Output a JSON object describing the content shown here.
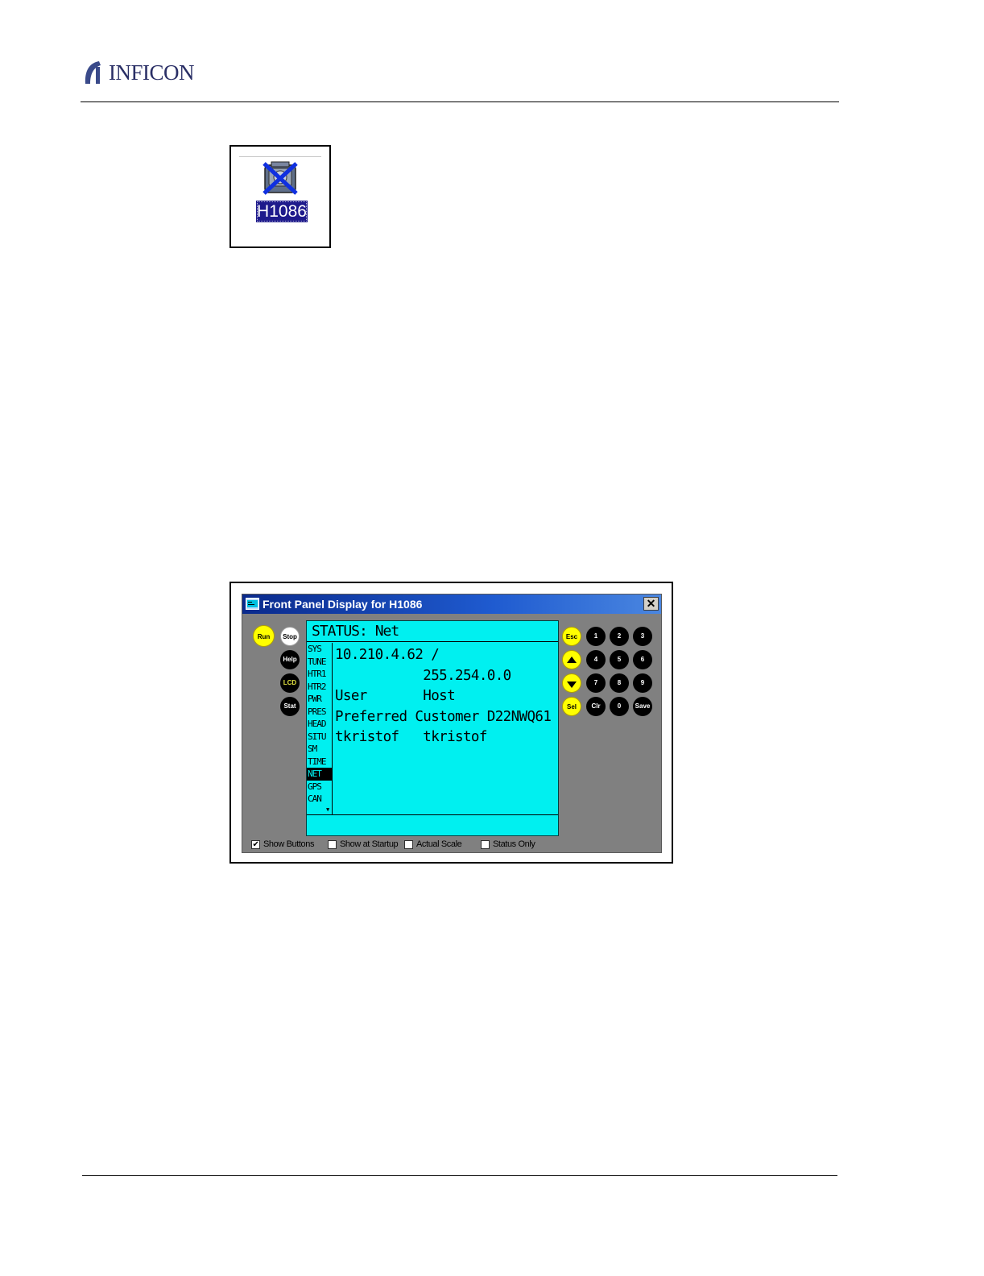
{
  "header": {
    "brand": "INFICON"
  },
  "icon_figure": {
    "label": "H1086",
    "device_icon": "disconnected-device-icon"
  },
  "window": {
    "title": "Front Panel Display for H1086",
    "title_icon": "app-icon",
    "close_icon": "close-icon",
    "close_glyph": "✕",
    "left_buttons": {
      "run": "Run",
      "stop": "Stop",
      "help": "Help",
      "lcd": "LCD",
      "stat": "Stat"
    },
    "right_buttons": {
      "esc": "Esc",
      "up": "up-arrow-icon",
      "down": "down-arrow-icon",
      "sel": "Sel",
      "k1": "1",
      "k2": "2",
      "k3": "3",
      "k4": "4",
      "k5": "5",
      "k6": "6",
      "k7": "7",
      "k8": "8",
      "k9": "9",
      "clr": "Clr",
      "k0": "0",
      "save": "Save"
    },
    "screen": {
      "header": "STATUS: Net",
      "menu": [
        "SYS",
        "TUNE",
        "HTR1",
        "HTR2",
        "PWR",
        "PRES",
        "HEAD",
        "SITU",
        "SM",
        "TIME",
        "NET",
        "GPS",
        "CAN"
      ],
      "selected_menu": "NET",
      "lines": [
        "10.210.4.62 /",
        "           255.254.0.0",
        "User       Host",
        "Preferred Customer D22NWQ61",
        "tkristof   tkristof"
      ],
      "colors": {
        "screen_bg": "#00f0f0",
        "window_bg": "#808080"
      }
    },
    "options": [
      {
        "label": "Show Buttons",
        "checked": true
      },
      {
        "label": "Show at Startup",
        "checked": false
      },
      {
        "label": "Actual Scale",
        "checked": false
      },
      {
        "label": "Status Only",
        "checked": false
      }
    ]
  }
}
